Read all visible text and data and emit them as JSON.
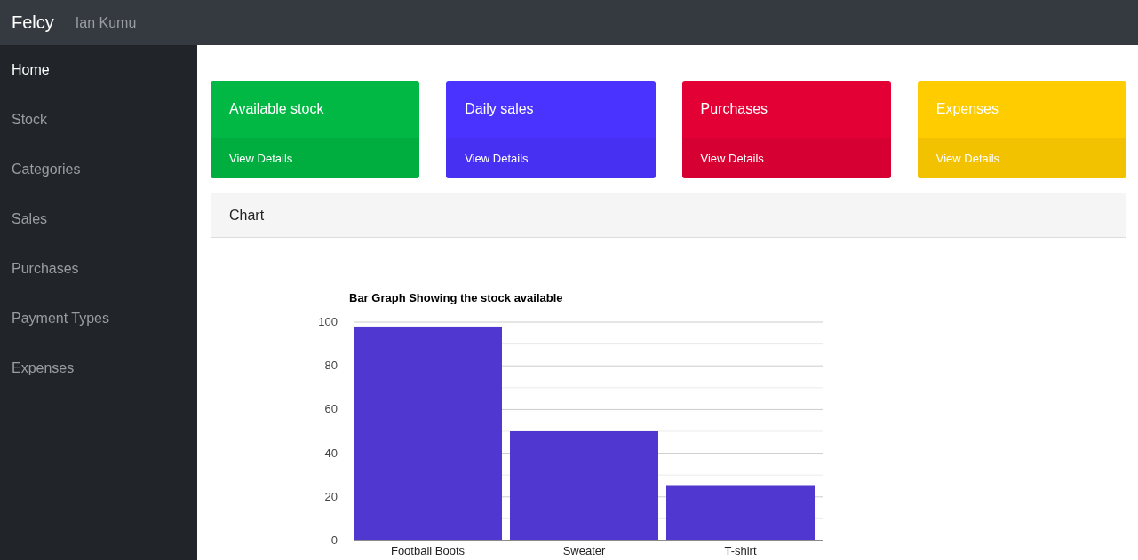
{
  "navbar": {
    "brand": "Felcy",
    "user": "Ian Kumu"
  },
  "sidebar": {
    "items": [
      {
        "label": "Home",
        "selected": true
      },
      {
        "label": "Stock",
        "selected": false
      },
      {
        "label": "Categories",
        "selected": false
      },
      {
        "label": "Sales",
        "selected": false
      },
      {
        "label": "Purchases",
        "selected": false
      },
      {
        "label": "Payment Types",
        "selected": false
      },
      {
        "label": "Expenses",
        "selected": false
      }
    ]
  },
  "cards": [
    {
      "title": "Available stock",
      "link": "View Details",
      "color": "#00b843"
    },
    {
      "title": "Daily sales",
      "link": "View Details",
      "color": "#4b33ff"
    },
    {
      "title": "Purchases",
      "link": "View Details",
      "color": "#e30035"
    },
    {
      "title": "Expenses",
      "link": "View Details",
      "color": "#ffcc00"
    }
  ],
  "chart_panel": {
    "heading": "Chart",
    "chart_data": {
      "type": "bar",
      "title": "Bar Graph Showing the stock available",
      "categories": [
        "Football Boots",
        "Sweater",
        "T-shirt"
      ],
      "series": [
        {
          "color": "#4f37cf",
          "values": [
            98,
            50,
            25
          ]
        }
      ],
      "grid": true,
      "ylim": [
        0,
        100
      ],
      "yticks": [
        0,
        20,
        40,
        60,
        80,
        100
      ]
    }
  }
}
